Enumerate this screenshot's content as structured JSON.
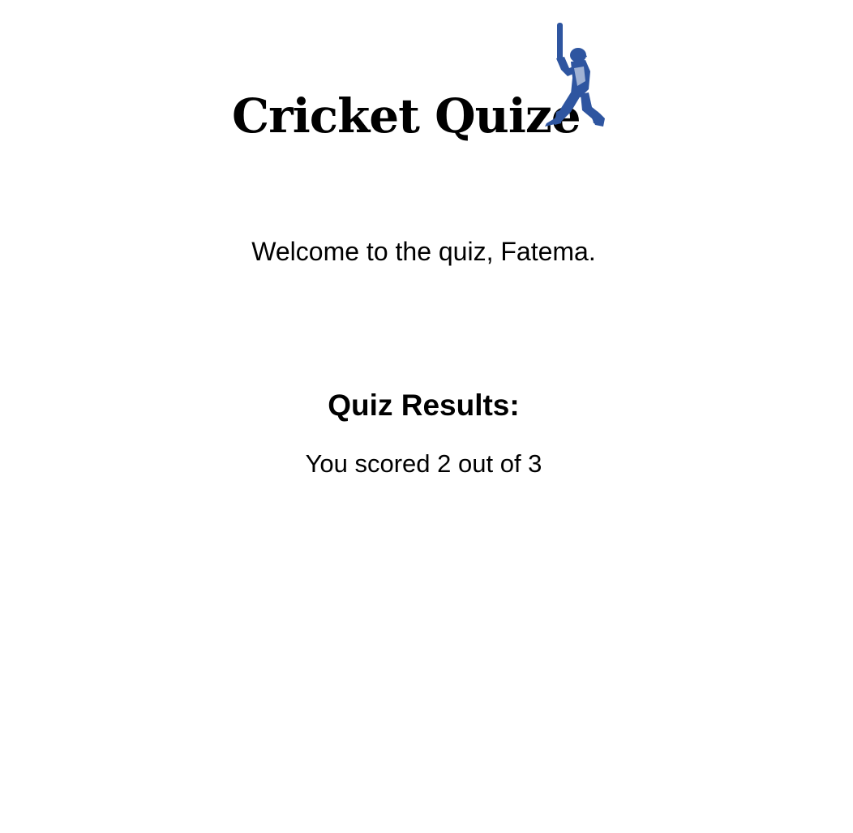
{
  "header": {
    "title": "Cricket Quize",
    "logo_icon": "cricket-batsman-icon",
    "logo_color": "#2e55a0"
  },
  "welcome": {
    "text": "Welcome to the quiz, Fatema."
  },
  "results": {
    "heading": "Quiz Results:",
    "score_text": "You scored 2 out of 3"
  }
}
